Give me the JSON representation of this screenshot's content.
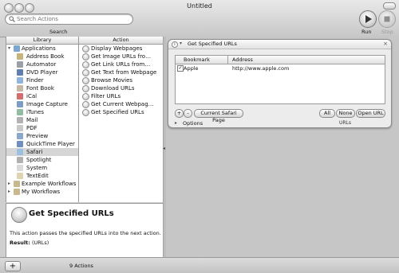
{
  "window": {
    "title": "Untitled"
  },
  "toolbar": {
    "search_placeholder": "Search Actions",
    "search_label": "Search",
    "run_label": "Run",
    "stop_label": "Stop"
  },
  "library": {
    "header": "Library",
    "items": [
      {
        "label": "Applications",
        "level": 0,
        "expanded": true,
        "icon": "applications-folder-icon"
      },
      {
        "label": "Address Book",
        "level": 1,
        "icon": "address-book-icon"
      },
      {
        "label": "Automator",
        "level": 1,
        "icon": "automator-icon"
      },
      {
        "label": "DVD Player",
        "level": 1,
        "icon": "dvd-player-icon"
      },
      {
        "label": "Finder",
        "level": 1,
        "icon": "finder-icon"
      },
      {
        "label": "Font Book",
        "level": 1,
        "icon": "font-book-icon"
      },
      {
        "label": "iCal",
        "level": 1,
        "icon": "ical-icon"
      },
      {
        "label": "Image Capture",
        "level": 1,
        "icon": "image-capture-icon"
      },
      {
        "label": "iTunes",
        "level": 1,
        "icon": "itunes-icon"
      },
      {
        "label": "Mail",
        "level": 1,
        "icon": "mail-icon"
      },
      {
        "label": "PDF",
        "level": 1,
        "icon": "pdf-icon"
      },
      {
        "label": "Preview",
        "level": 1,
        "icon": "preview-icon"
      },
      {
        "label": "QuickTime Player",
        "level": 1,
        "icon": "quicktime-icon"
      },
      {
        "label": "Safari",
        "level": 1,
        "icon": "safari-icon",
        "selected": true
      },
      {
        "label": "Spotlight",
        "level": 1,
        "icon": "spotlight-icon"
      },
      {
        "label": "System",
        "level": 1,
        "icon": "system-icon"
      },
      {
        "label": "TextEdit",
        "level": 1,
        "icon": "textedit-icon"
      },
      {
        "label": "Example Workflows",
        "level": 0,
        "expanded": false,
        "icon": "folder-icon"
      },
      {
        "label": "My Workflows",
        "level": 0,
        "expanded": false,
        "icon": "folder-icon"
      }
    ]
  },
  "actions": {
    "header": "Action",
    "items": [
      {
        "label": "Display Webpages",
        "icon": "safari-action-icon"
      },
      {
        "label": "Get Image URLs fro…",
        "icon": "safari-action-icon"
      },
      {
        "label": "Get Link URLs from…",
        "icon": "safari-action-icon"
      },
      {
        "label": "Get Text from Webpage",
        "icon": "safari-action-icon"
      },
      {
        "label": "Browse Movies",
        "icon": "safari-action-icon"
      },
      {
        "label": "Download URLs",
        "icon": "safari-action-icon"
      },
      {
        "label": "Filter URLs",
        "icon": "safari-action-icon"
      },
      {
        "label": "Get Current Webpag…",
        "icon": "safari-action-icon"
      },
      {
        "label": "Get Specified URLs",
        "icon": "safari-action-icon"
      }
    ],
    "count_label": "9 Actions"
  },
  "description": {
    "title": "Get Specified URLs",
    "text": "This action passes the specified URLs into the next action.",
    "result_label": "Result:",
    "result_value": "(URLs)"
  },
  "action_card": {
    "title": "Get Specified URLs",
    "table": {
      "columns": [
        "Bookmark",
        "Address"
      ],
      "rows": [
        {
          "checked": true,
          "bookmark": "Apple",
          "address": "http://www.apple.com"
        }
      ]
    },
    "add_label": "+",
    "remove_label": "-",
    "current_page_label": "Current Safari Page",
    "all_label": "All",
    "none_label": "None",
    "open_url_label": "Open URL",
    "options_label": "Options",
    "output_type": "URLs"
  },
  "bottom": {
    "add_label": "+"
  }
}
